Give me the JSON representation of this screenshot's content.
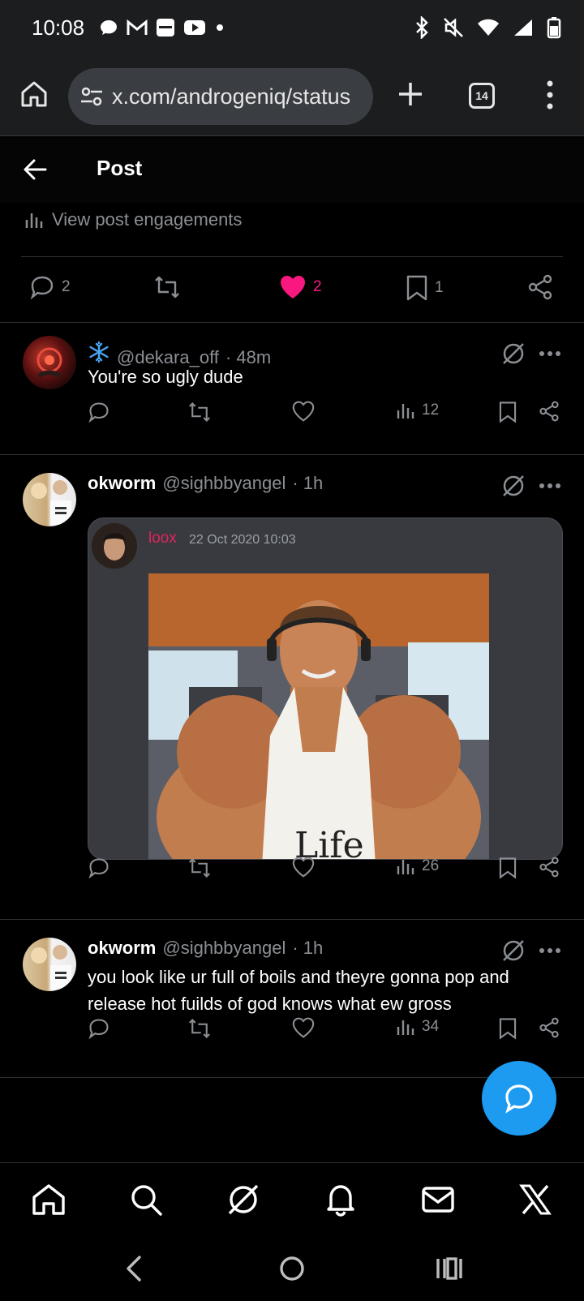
{
  "status_bar": {
    "time": "10:08",
    "left_icons": [
      "chat-bubble-icon",
      "gmail-icon",
      "samsung-icon",
      "youtube-icon",
      "dot-icon"
    ],
    "right_icons": [
      "bluetooth-icon",
      "mute-icon",
      "wifi-icon",
      "signal-icon",
      "battery-icon"
    ]
  },
  "browser": {
    "url": "x.com/androgeniq/status",
    "tab_count": "14"
  },
  "header": {
    "title": "Post"
  },
  "engagements": {
    "label": "View post engagements"
  },
  "main_actions": {
    "replies": "2",
    "likes": "2",
    "bookmarks": "1",
    "like_color": "#f91880"
  },
  "replies": [
    {
      "name": "",
      "badge_icon": "snowflake-icon",
      "handle": "@dekara_off",
      "time": "· 48m",
      "text": "You're so ugly dude",
      "views": "12"
    },
    {
      "name": "okworm",
      "handle": "@sighbbyangel",
      "time": "· 1h",
      "text": "",
      "views": "26",
      "quote": {
        "name": "loox",
        "date": "22 Oct 2020 10:03"
      }
    },
    {
      "name": "okworm",
      "handle": "@sighbbyangel",
      "time": "· 1h",
      "text": "you look like ur full of boils and theyre gonna pop and release hot fuilds of god knows what ew gross",
      "views": "34"
    }
  ],
  "colors": {
    "accent": "#1d9bf0",
    "muted": "#8b8f94",
    "like": "#f91880",
    "quote_name": "#e0245e"
  }
}
